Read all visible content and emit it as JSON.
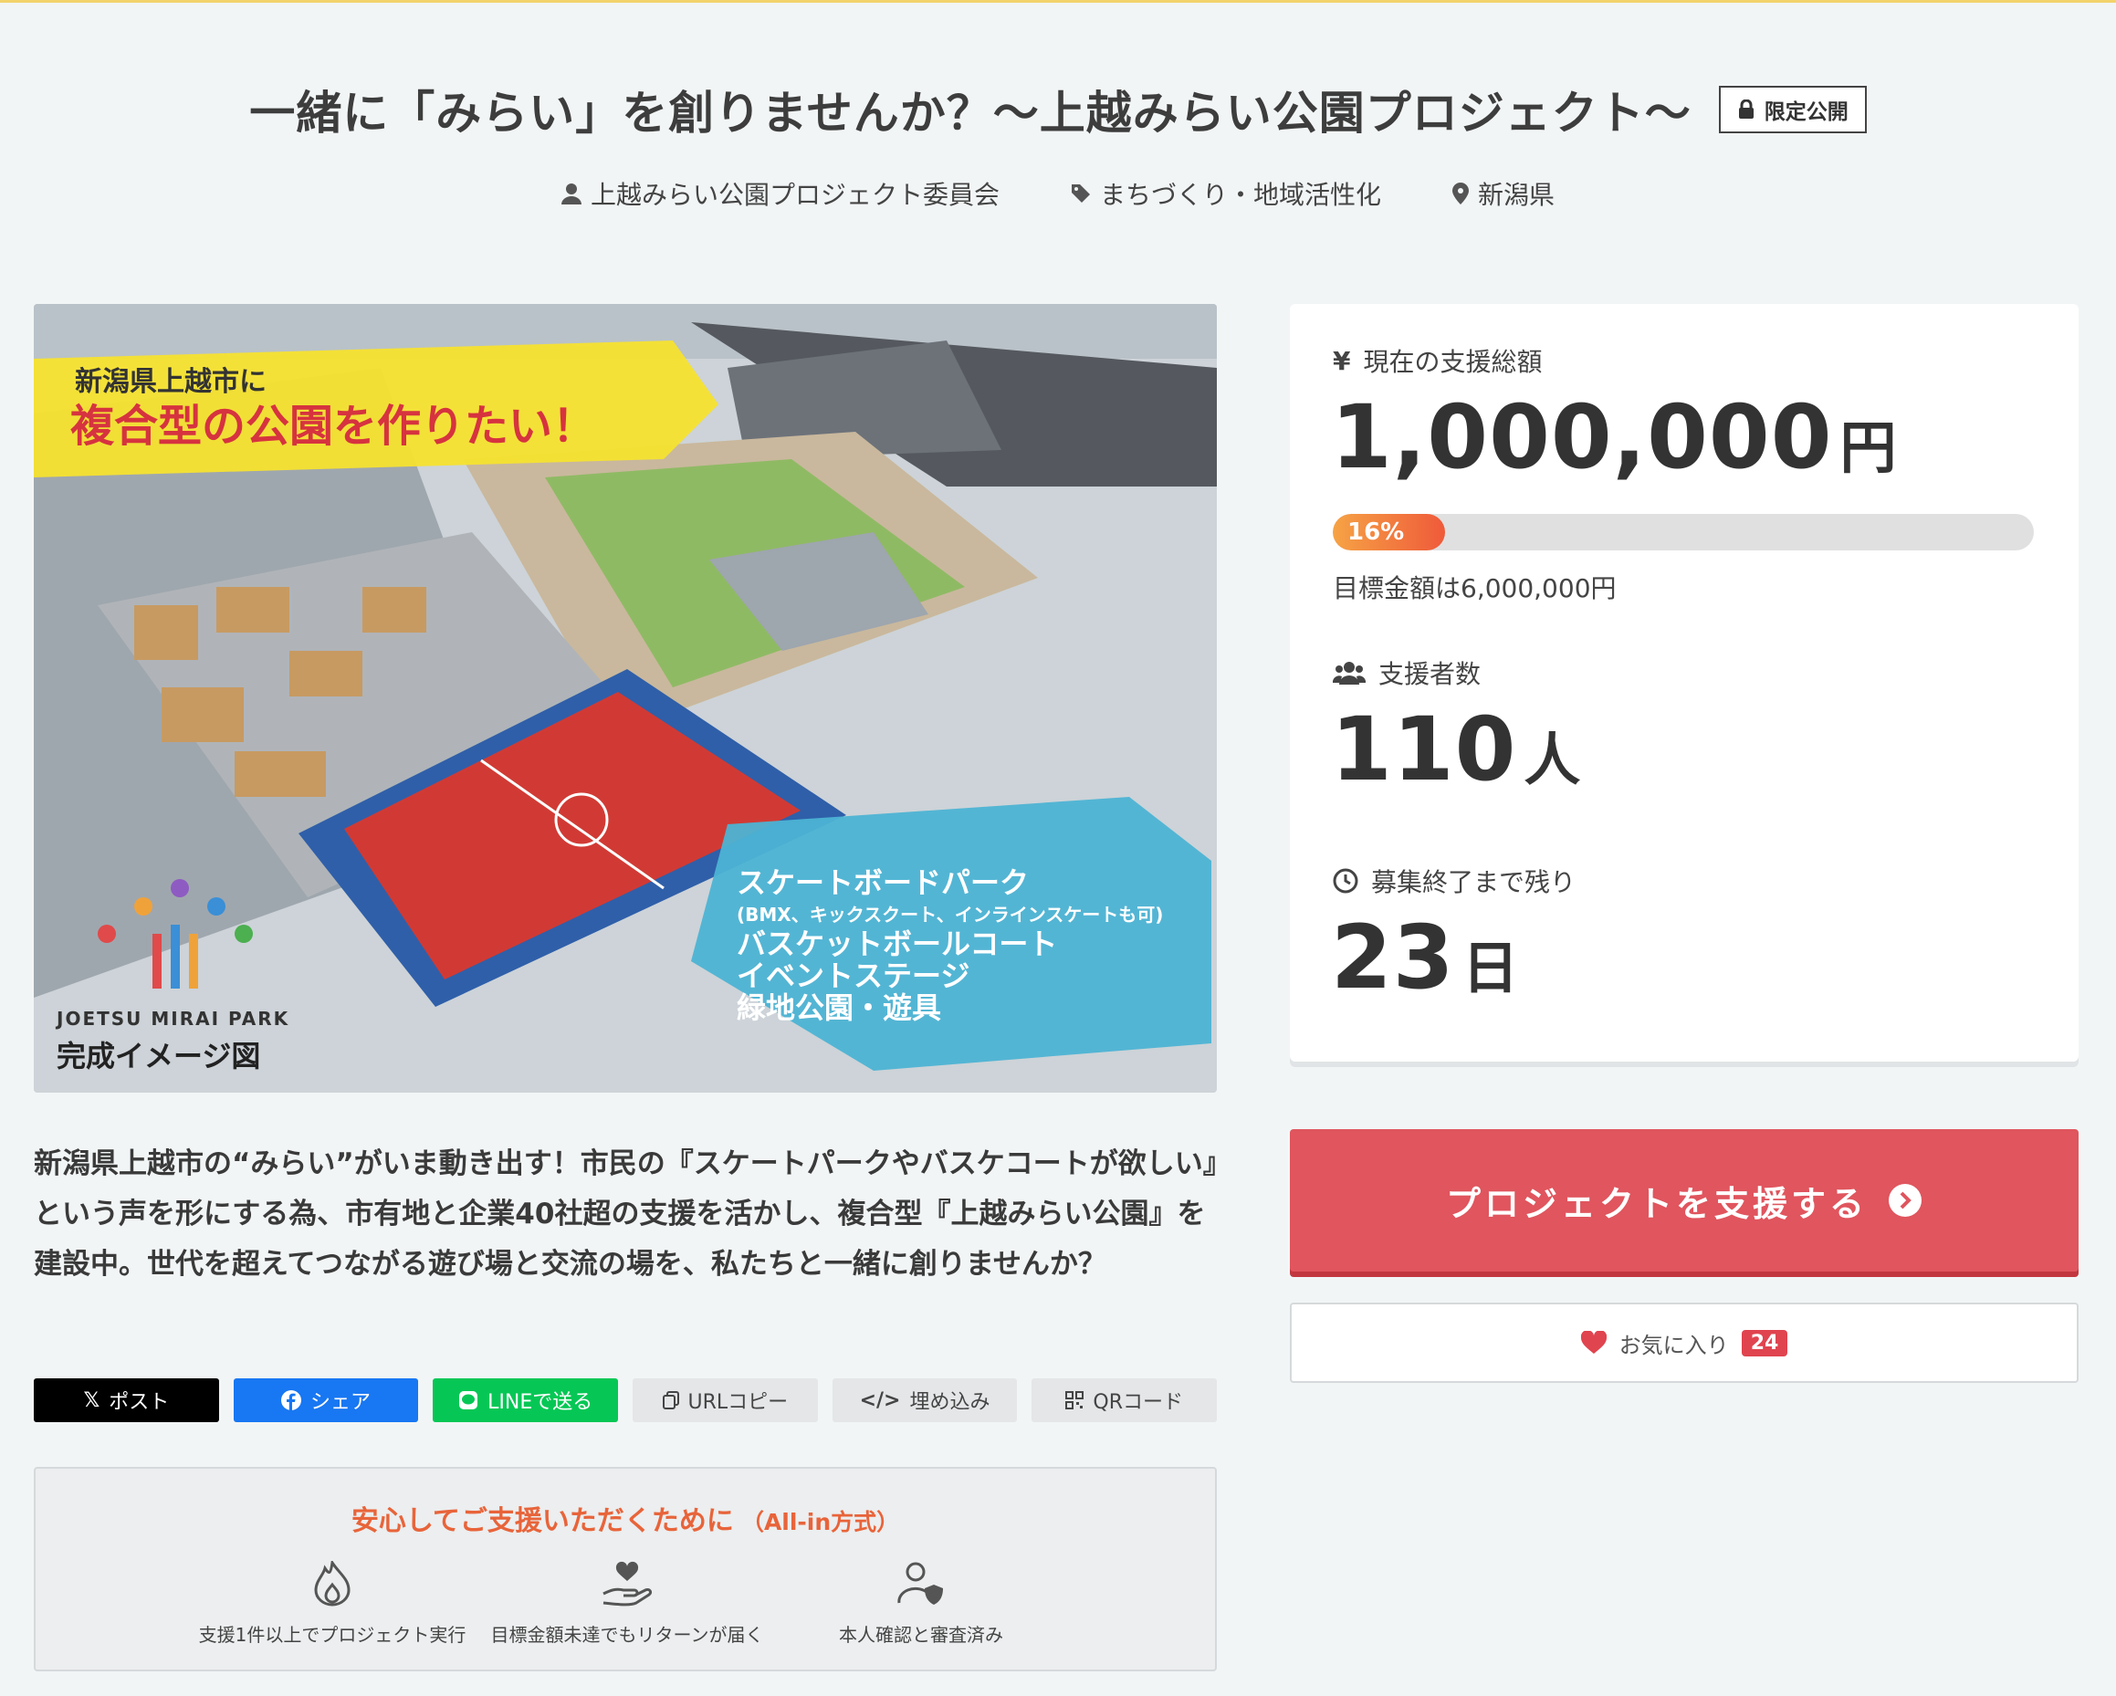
{
  "project": {
    "title": "一緒に「みらい」を創りませんか？〜上越みらい公園プロジェクト〜",
    "visibility_badge": "限定公開",
    "owner": "上越みらい公園プロジェクト委員会",
    "category": "まちづくり・地域活性化",
    "location": "新潟県"
  },
  "hero": {
    "headline_small": "新潟県上越市に",
    "headline_large": "複合型の公園を作りたい！",
    "features": [
      "スケートボードパーク",
      "(BMX、キックスクート、インラインスケートも可)",
      "バスケットボールコート",
      "イベントステージ",
      "緑地公園・遊具"
    ],
    "logo_text": "JOETSU MIRAI PARK",
    "caption": "完成イメージ図"
  },
  "summary": "新潟県上越市の“みらい”がいま動き出す！市民の『スケートパークやバスケコートが欲しい』という声を形にする為、市有地と企業40社超の支援を活かし、複合型『上越みらい公園』を建設中。世代を超えてつながる遊び場と交流の場を、私たちと一緒に創りませんか？",
  "share": {
    "x": "ポスト",
    "facebook": "シェア",
    "line": "LINEで送る",
    "url": "URLコピー",
    "embed": "埋め込み",
    "qr": "QRコード"
  },
  "assurance": {
    "title": "安心してご支援いただくために",
    "subtitle": "（All-in方式）",
    "items": [
      "支援1件以上でプロジェクト実行",
      "目標金額未達でもリターンが届く",
      "本人確認と審査済み"
    ]
  },
  "stats": {
    "amount_label": "現在の支援総額",
    "amount_value": "1,000,000",
    "amount_unit": "円",
    "progress_percent": 16,
    "progress_label": "16%",
    "goal_text": "目標金額は6,000,000円",
    "supporters_label": "支援者数",
    "supporters_value": "110",
    "supporters_unit": "人",
    "remaining_label": "募集終了まで残り",
    "remaining_value": "23",
    "remaining_unit": "日"
  },
  "actions": {
    "support_label": "プロジェクトを支援する",
    "favorite_label": "お気に入り",
    "favorite_count": "24"
  },
  "colors": {
    "accent_red": "#e0555e",
    "assurance_orange": "#e8643a",
    "progress_start": "#f6a345",
    "progress_end": "#ef5a3a"
  }
}
